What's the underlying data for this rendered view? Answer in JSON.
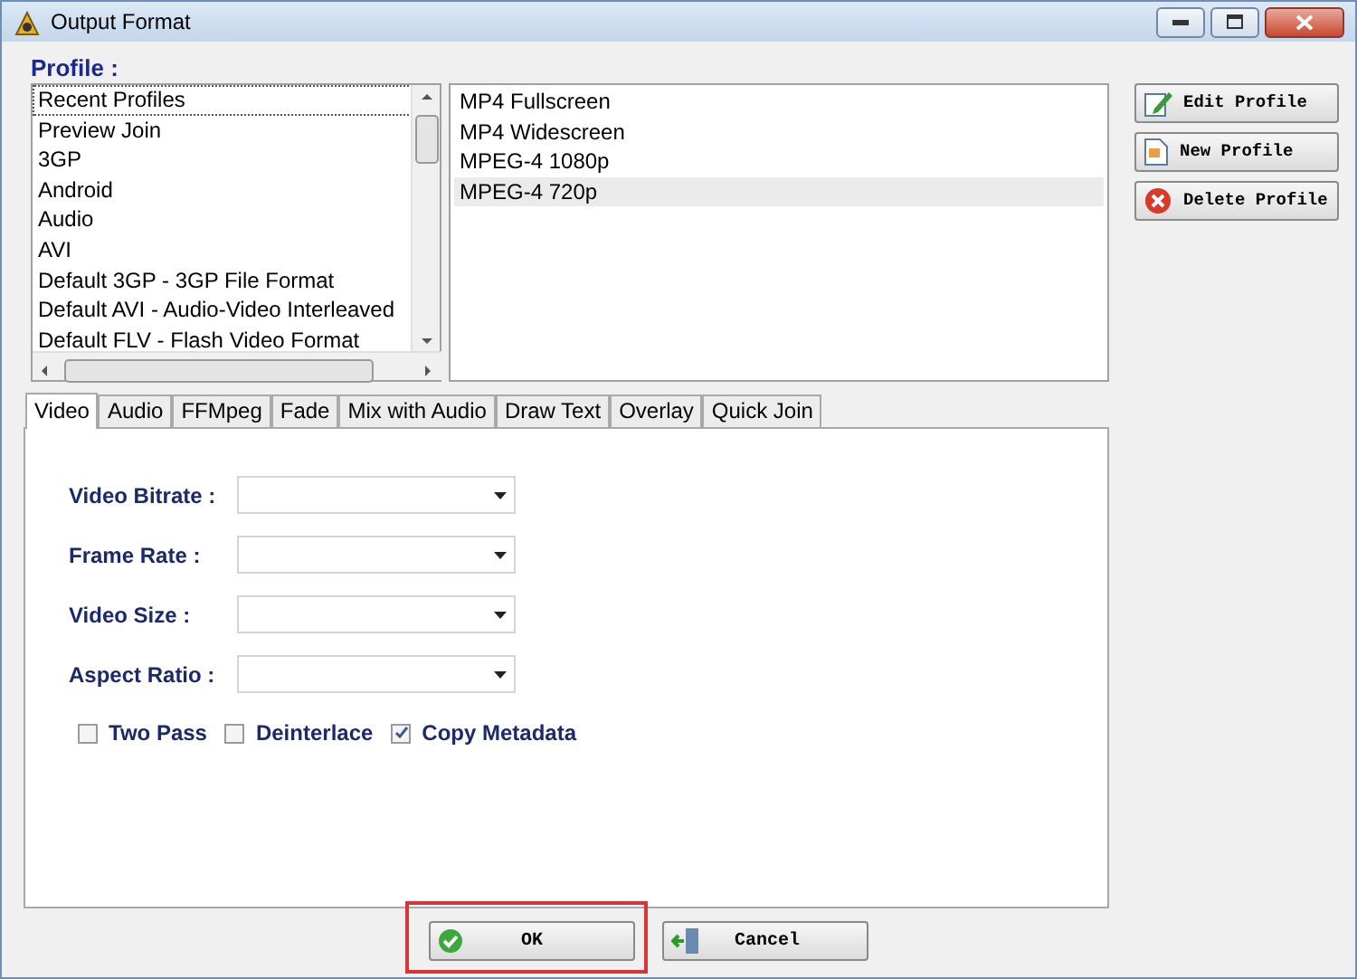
{
  "window": {
    "title": "Output Format"
  },
  "profile_label": "Profile :",
  "profile_groups": [
    {
      "label": "Recent Profiles",
      "selected": true
    },
    {
      "label": "Preview Join",
      "selected": false
    },
    {
      "label": "3GP",
      "selected": false
    },
    {
      "label": "Android",
      "selected": false
    },
    {
      "label": "Audio",
      "selected": false
    },
    {
      "label": "AVI",
      "selected": false
    },
    {
      "label": "Default 3GP - 3GP File Format",
      "selected": false
    },
    {
      "label": "Default AVI - Audio-Video Interleaved",
      "selected": false
    },
    {
      "label": "Default FLV - Flash Video Format",
      "selected": false
    }
  ],
  "profiles": [
    {
      "label": "MP4 Fullscreen",
      "selected": false
    },
    {
      "label": "MP4 Widescreen",
      "selected": false
    },
    {
      "label": "MPEG-4 1080p",
      "selected": false
    },
    {
      "label": "MPEG-4 720p",
      "selected": true
    }
  ],
  "profile_buttons": [
    {
      "label": "Edit Profile",
      "kind": "edit"
    },
    {
      "label": "New Profile",
      "kind": "new"
    },
    {
      "label": "Delete Profile",
      "kind": "delete"
    }
  ],
  "tabs": [
    {
      "label": "Video",
      "selected": true
    },
    {
      "label": "Audio",
      "selected": false
    },
    {
      "label": "FFMpeg",
      "selected": false
    },
    {
      "label": "Fade",
      "selected": false
    },
    {
      "label": "Mix with Audio",
      "selected": false
    },
    {
      "label": "Draw Text",
      "selected": false
    },
    {
      "label": "Overlay",
      "selected": false
    },
    {
      "label": "Quick Join",
      "selected": false
    }
  ],
  "fields": [
    {
      "label": "Video Bitrate :"
    },
    {
      "label": "Frame Rate :"
    },
    {
      "label": "Video Size :"
    },
    {
      "label": "Aspect Ratio :"
    }
  ],
  "options": [
    {
      "label": "Two Pass",
      "checked": false
    },
    {
      "label": "Deinterlace",
      "checked": false
    },
    {
      "label": "Copy Metadata",
      "checked": true
    }
  ],
  "buttons": [
    {
      "label": "OK",
      "kind": "ok",
      "highlighted": true
    },
    {
      "label": "Cancel",
      "kind": "cancel",
      "highlighted": false
    }
  ]
}
